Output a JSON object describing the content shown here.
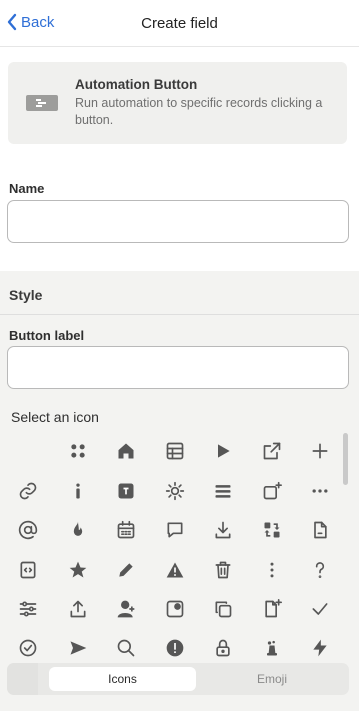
{
  "header": {
    "back_label": "Back",
    "title": "Create field"
  },
  "automation": {
    "icon": "automation-button-icon",
    "title": "Automation Button",
    "description": "Run automation to specific records clicking a button."
  },
  "name": {
    "label": "Name",
    "value": ""
  },
  "style": {
    "title": "Style",
    "button_label": {
      "label": "Button label",
      "value": ""
    },
    "select_icon_label": "Select an icon"
  },
  "icons": [
    [
      "",
      "grid-dots",
      "home",
      "table",
      "play",
      "external-link",
      "plus"
    ],
    [
      "link",
      "info-i",
      "app-box",
      "gear",
      "hamburger",
      "square-plus",
      "more-dots"
    ],
    [
      "at",
      "fire",
      "calendar",
      "chat",
      "download",
      "swap",
      "document"
    ],
    [
      "code-file",
      "star",
      "pencil",
      "warning",
      "trash",
      "vertical-dots",
      "question"
    ],
    [
      "sliders",
      "upload",
      "user-plus",
      "square-record",
      "copy",
      "document-plus",
      "check"
    ],
    [
      "check-circle",
      "send",
      "search",
      "alert-circle",
      "lock",
      "hat",
      "bolt"
    ]
  ],
  "tabs": {
    "icons": "Icons",
    "emoji": "Emoji",
    "active": "icons"
  },
  "colors": {
    "accent": "#2f6fd6",
    "icon": "#565656",
    "panel": "#f3f3f1"
  }
}
